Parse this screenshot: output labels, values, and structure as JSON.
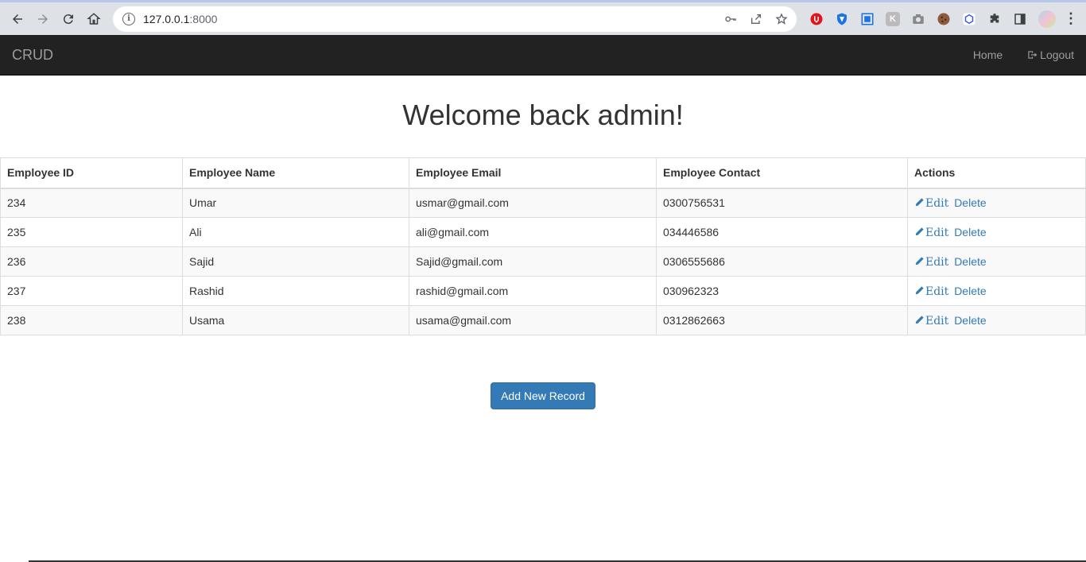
{
  "browser": {
    "url_host": "127.0.0.1",
    "url_port": ":8000",
    "extensions": [
      "adblock-icon",
      "shield-extension-icon",
      "screenshot-extension-icon",
      "extension-icon",
      "camera-extension-icon",
      "cookie-extension-icon",
      "cube-extension-icon",
      "puzzle-icon",
      "side-panel-icon",
      "profile-avatar"
    ]
  },
  "navbar": {
    "brand": "CRUD",
    "home": "Home",
    "logout": "Logout"
  },
  "main": {
    "title": "Welcome back admin!",
    "table": {
      "headers": [
        "Employee ID",
        "Employee Name",
        "Employee Email",
        "Employee Contact",
        "Actions"
      ],
      "rows": [
        {
          "id": "234",
          "name": "Umar",
          "email": "usmar@gmail.com",
          "contact": "0300756531"
        },
        {
          "id": "235",
          "name": "Ali",
          "email": "ali@gmail.com",
          "contact": "034446586"
        },
        {
          "id": "236",
          "name": "Sajid",
          "email": "Sajid@gmail.com",
          "contact": "0306555686"
        },
        {
          "id": "237",
          "name": "Rashid",
          "email": "rashid@gmail.com",
          "contact": "030962323"
        },
        {
          "id": "238",
          "name": "Usama",
          "email": "usama@gmail.com",
          "contact": "0312862663"
        }
      ],
      "edit_label": "Edit",
      "delete_label": "Delete"
    },
    "add_button": "Add New Record"
  },
  "colors": {
    "navbar_bg": "#222222",
    "link": "#337ab7",
    "primary_button": "#337ab7"
  }
}
